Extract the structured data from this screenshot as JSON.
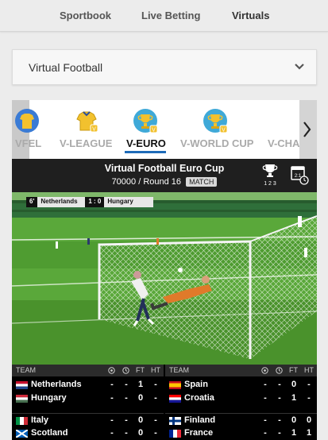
{
  "nav": {
    "tabs": [
      {
        "label": "Sportbook"
      },
      {
        "label": "Live Betting"
      },
      {
        "label": "Virtuals"
      }
    ]
  },
  "section": {
    "label": "Virtual Football"
  },
  "leagues": [
    {
      "label": "VFEL"
    },
    {
      "label": "V-LEAGUE"
    },
    {
      "label": "V-EURO",
      "active": true
    },
    {
      "label": "V-WORLD CUP"
    },
    {
      "label": "V-CHAMP"
    }
  ],
  "info": {
    "title": "Virtual Football Euro Cup",
    "round": "70000 / Round 16",
    "match_label": "MATCH",
    "standings_ticks": "1 2 3",
    "calendar_day": "2:1"
  },
  "video": {
    "minute": "6'",
    "home": "Netherlands",
    "score": "1 : 0",
    "away": "Hungary"
  },
  "results": {
    "header": {
      "team": "TEAM",
      "ft": "FT",
      "ht": "HT"
    },
    "matches": [
      {
        "home": "Netherlands",
        "away": "Hungary",
        "home_ft": "1",
        "home_ht": "-",
        "away_ft": "0",
        "away_ht": "-",
        "home_c1": "-",
        "home_c2": "-",
        "away_c1": "-",
        "away_c2": "-"
      },
      {
        "home": "Spain",
        "away": "Croatia",
        "home_ft": "0",
        "home_ht": "-",
        "away_ft": "1",
        "away_ht": "-",
        "home_c1": "-",
        "home_c2": "-",
        "away_c1": "-",
        "away_c2": "-"
      },
      {
        "home": "Italy",
        "away": "Scotland",
        "home_ft": "0",
        "home_ht": "-",
        "away_ft": "0",
        "away_ht": "-",
        "home_c1": "-",
        "home_c2": "-",
        "away_c1": "-",
        "away_c2": "-"
      },
      {
        "home": "Finland",
        "away": "France",
        "home_ft": "0",
        "home_ht": "0",
        "away_ft": "1",
        "away_ht": "1",
        "home_c1": "-",
        "home_c2": "-",
        "away_c1": "-",
        "away_c2": "-"
      }
    ]
  },
  "colors": {
    "accent": "#1e6bb8",
    "pitch": "#4d9a2e"
  }
}
